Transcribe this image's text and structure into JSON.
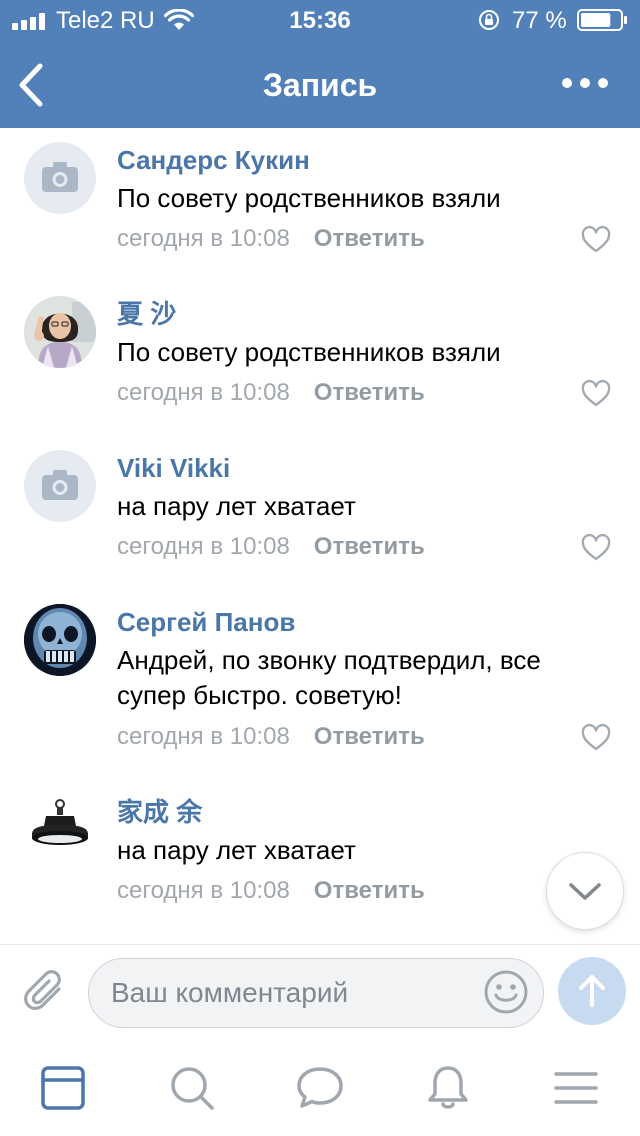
{
  "status_bar": {
    "carrier": "Tele2 RU",
    "time": "15:36",
    "battery_percent": "77 %",
    "battery_level": 0.77,
    "icons": [
      "signal-icon",
      "wifi-icon",
      "rotation-lock-icon",
      "battery-icon"
    ]
  },
  "nav": {
    "title": "Запись",
    "back_icon": "chevron-left-icon",
    "more_icon": "more-dots-icon"
  },
  "comments": [
    {
      "author": "Сандерс Кукин",
      "text": "По совету родственников взяли",
      "time": "сегодня в 10:08",
      "reply_label": "Ответить",
      "avatar": "camera-placeholder"
    },
    {
      "author": "夏 沙",
      "text": "По совету родственников взяли",
      "time": "сегодня в 10:08",
      "reply_label": "Ответить",
      "avatar": "photo-person"
    },
    {
      "author": "Viki Vikki",
      "text": "на пару лет хватает",
      "time": "сегодня в 10:08",
      "reply_label": "Ответить",
      "avatar": "camera-placeholder"
    },
    {
      "author": "Сергей Панов",
      "text": "Андрей, по звонку подтвердил, все супер быстро. советую!",
      "time": "сегодня в 10:08",
      "reply_label": "Ответить",
      "avatar": "photo-skull"
    },
    {
      "author": "家成 余",
      "text": "на пару лет хватает",
      "time": "сегодня в 10:08",
      "reply_label": "Ответить",
      "avatar": "photo-lamp"
    }
  ],
  "composer": {
    "placeholder": "Ваш комментарий",
    "value": ""
  },
  "tabbar": {
    "items": [
      "news-icon",
      "search-icon",
      "messages-icon",
      "notifications-icon",
      "menu-icon"
    ],
    "active": "news-icon"
  },
  "colors": {
    "header": "#5181b8",
    "link": "#4a76a8",
    "muted": "#a2a7ad",
    "send_inactive": "#c7daf0"
  }
}
